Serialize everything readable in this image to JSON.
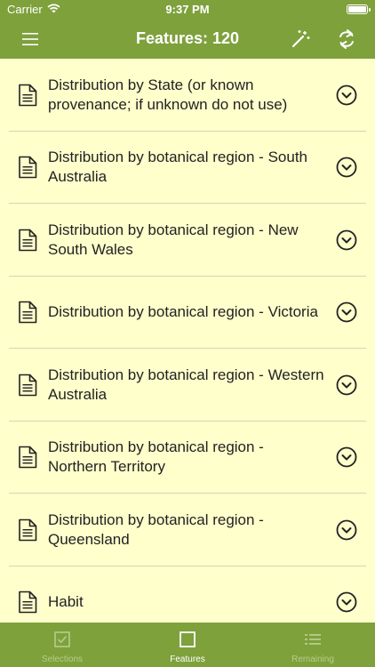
{
  "status": {
    "carrier": "Carrier",
    "time": "9:37 PM"
  },
  "header": {
    "title": "Features: 120",
    "menu_icon": "hamburger-menu-icon",
    "wand_icon": "magic-wand-icon",
    "refresh_icon": "refresh-icon"
  },
  "features": [
    {
      "label": "Distribution by State (or known provenance; if unknown do not use)"
    },
    {
      "label": "Distribution by botanical region - South Australia"
    },
    {
      "label": "Distribution by botanical region - New South Wales"
    },
    {
      "label": "Distribution by botanical region - Victoria"
    },
    {
      "label": "Distribution by botanical region - Western Australia"
    },
    {
      "label": "Distribution by botanical region - Northern Territory"
    },
    {
      "label": "Distribution by botanical region - Queensland"
    },
    {
      "label": "Habit"
    }
  ],
  "tabs": [
    {
      "label": "Selections",
      "icon": "checkbox-icon"
    },
    {
      "label": "Features",
      "icon": "square-icon"
    },
    {
      "label": "Remaining",
      "icon": "list-icon"
    }
  ],
  "colors": {
    "bar": "#7ea13c",
    "background": "#ffffcc",
    "text": "#222222"
  }
}
